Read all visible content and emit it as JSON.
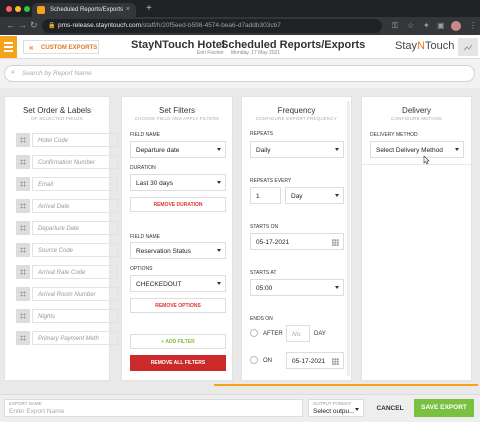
{
  "browser": {
    "tab_title": "Scheduled Reports/Exports",
    "tab_close": "×",
    "new_tab": "+",
    "url_host": "pms-release.stayntouch.com",
    "url_path": "/staff/h/20f5eed-b598-4574-bea6-d7addb303cb7",
    "back_glyph": "←",
    "forward_glyph": "→",
    "reload_glyph": "↻",
    "lock_glyph": "🔒",
    "key_glyph": "⚿",
    "star_glyph": "☆",
    "ext_glyph": "✦",
    "menu_glyph": "⋮"
  },
  "header": {
    "back_label": "CUSTOM EXPORTS",
    "back_glyph": "«",
    "hotel_name": "StayNTouch Hotel",
    "page_title": "Scheduled Reports/Exports",
    "user_name": "Erin Fischer",
    "business_date": "Monday, 17 May 2021",
    "brand_left": "Stay",
    "brand_mid": "N",
    "brand_right": "Touch"
  },
  "search": {
    "placeholder": "Search by Report Name",
    "icon": "search-icon",
    "glyph": "⌕"
  },
  "order_panel": {
    "title": "Set Order & Labels",
    "subtitle": "OF SELECTED FIELDS",
    "fields": [
      "Hotel Code",
      "Confirmation Number",
      "Email",
      "Arrival Date",
      "Departure Date",
      "Source Code",
      "Arrival Rate Code",
      "Arrival Room Number",
      "Nights",
      "Primary Payment Meth"
    ]
  },
  "filters_panel": {
    "title": "Set Filters",
    "subtitle": "CHOOSE FIELD AND APPLY FILTERS",
    "field_name_label_1": "FIELD NAME",
    "field_name_value_1": "Departure date",
    "duration_label": "DURATION",
    "duration_value": "Last 30 days",
    "remove_duration": "REMOVE DURATION",
    "field_name_label_2": "FIELD NAME",
    "field_name_value_2": "Reservation Status",
    "options_label": "OPTIONS",
    "options_value": "CHECKEDOUT",
    "remove_options": "REMOVE OPTIONS",
    "add_filter": "+ ADD FILTER",
    "remove_all": "REMOVE ALL FILTERS"
  },
  "frequency_panel": {
    "title": "Frequency",
    "subtitle": "CONFIGURE EXPORT FREQUENCY",
    "repeats_label": "REPEATS",
    "repeats_value": "Daily",
    "repeats_every_label": "REPEATS EVERY",
    "repeats_every_value": "1",
    "repeats_every_unit": "Day",
    "starts_on_label": "STARTS ON",
    "starts_on_value": "05-17-2021",
    "starts_at_label": "STARTS AT",
    "starts_at_value": "05:00",
    "ends_on_label": "ENDS ON",
    "after_label": "AFTER",
    "after_placeholder": "No.",
    "after_unit": "DAY",
    "on_label": "ON",
    "on_value": "05-17-2021"
  },
  "delivery_panel": {
    "title": "Delivery",
    "subtitle": "CONFIGURE METHOD",
    "method_label": "DELIVERY METHOD",
    "method_value": "Select Delivery Method"
  },
  "footer": {
    "export_name_label": "EXPORT NAME",
    "export_name_placeholder": "Enter Export Name",
    "output_format_label": "OUTPUT FORMAT",
    "output_format_value": "Select outpu...",
    "cancel_label": "CANCEL",
    "save_label": "SAVE EXPORT"
  },
  "colors": {
    "accent": "#f6a21a",
    "danger": "#cc2a2a",
    "save": "#7ac142"
  }
}
